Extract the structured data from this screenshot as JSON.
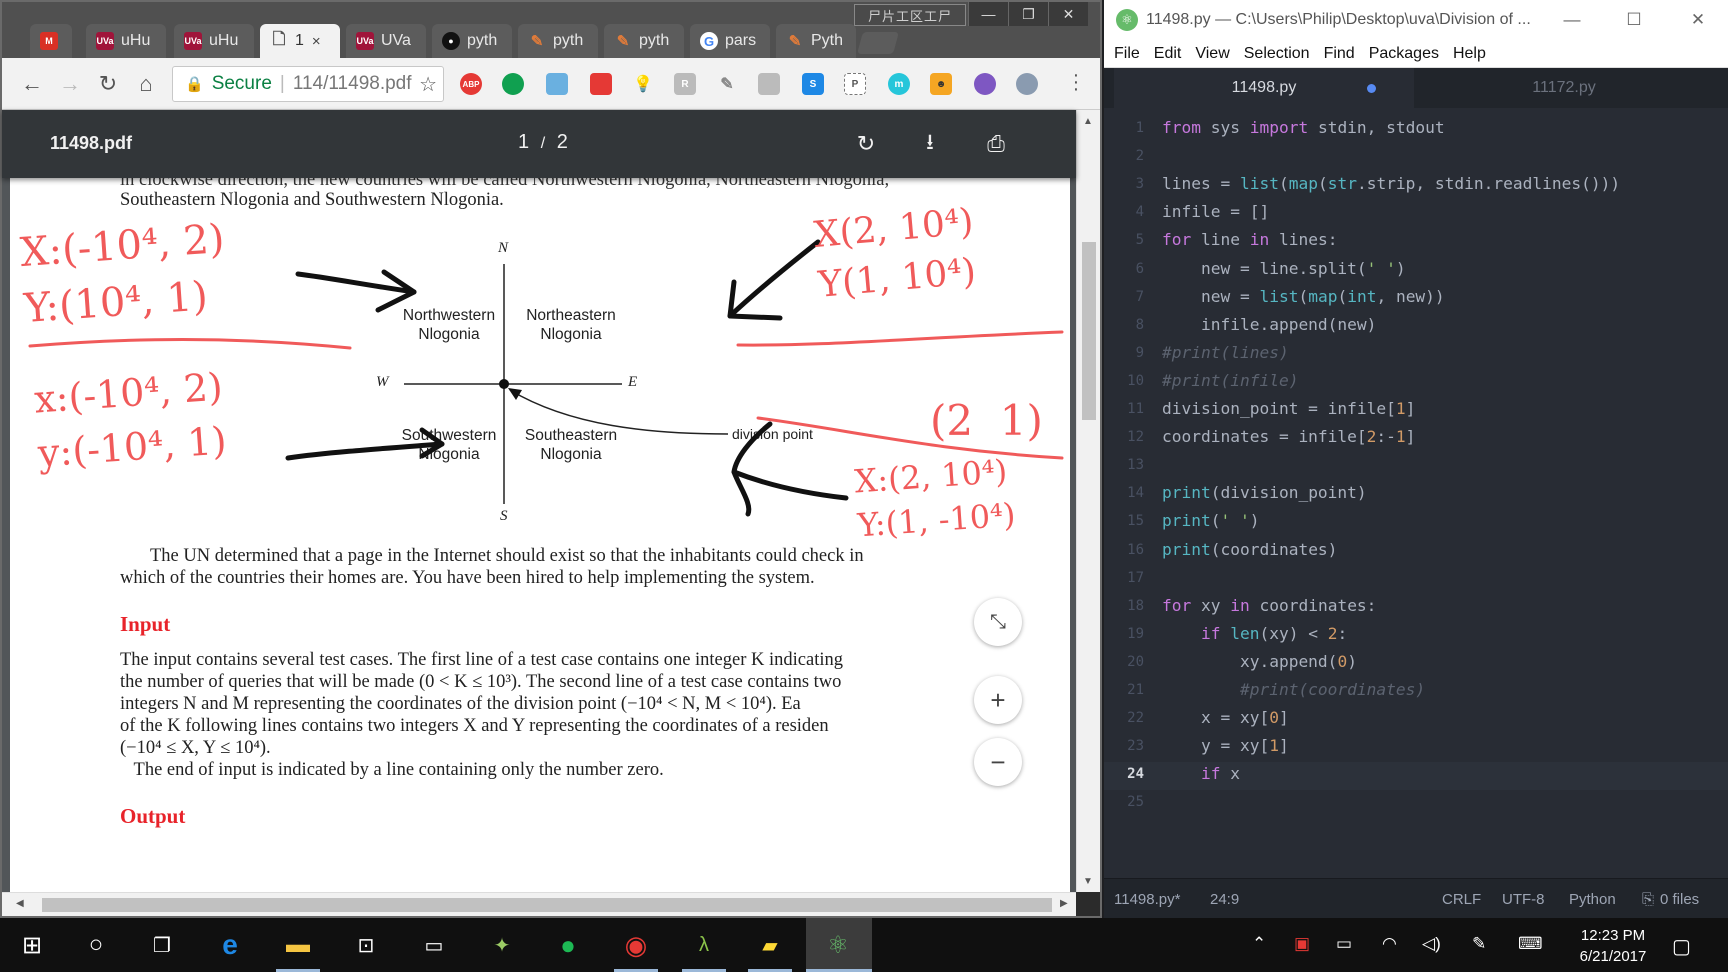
{
  "chrome": {
    "ime_indicator": "尸片工区工尸",
    "tabs": [
      {
        "label": "",
        "icon": "gmail-icon"
      },
      {
        "label": "uHu",
        "icon": "uva-icon"
      },
      {
        "label": "uHu",
        "icon": "uva-icon"
      },
      {
        "label": "1",
        "icon": "document-icon",
        "active": true
      },
      {
        "label": "UVa",
        "icon": "uva-icon"
      },
      {
        "label": "pyth",
        "icon": "github-icon"
      },
      {
        "label": "pyth",
        "icon": "bookmark-icon"
      },
      {
        "label": "pyth",
        "icon": "bookmark-icon"
      },
      {
        "label": "pars",
        "icon": "google-icon"
      },
      {
        "label": "Pyth",
        "icon": "bookmark-icon"
      }
    ],
    "address": {
      "secure_label": "Secure",
      "url": "114/11498.pdf"
    },
    "extensions": [
      "ABP"
    ]
  },
  "pdf": {
    "file_name": "11498.pdf",
    "page_current": "1",
    "page_total": "2",
    "cut_line": "in clockwise direction, the new countries will be called Northwestern Nlogonia, Northeastern Nlogonia,",
    "intro_line": "Southeastern Nlogonia and Southwestern Nlogonia.",
    "diagram": {
      "north": "N",
      "south": "S",
      "west": "W",
      "east": "E",
      "nw": [
        "Northwestern",
        "Nlogonia"
      ],
      "ne": [
        "Northeastern",
        "Nlogonia"
      ],
      "sw": [
        "Southwestern",
        "Nlogonia"
      ],
      "se": [
        "Southeastern",
        "Nlogonia"
      ],
      "division_point": "division point"
    },
    "paragraph1": [
      "The UN determined that a page in the Internet should exist so that the inhabitants could check in",
      "which of the countries their homes are. You have been hired to help implementing the system."
    ],
    "input_heading": "Input",
    "input_lines": [
      "The input contains several test cases.  The first line of a test case contains one integer K indicating",
      "the number of queries that will be made (0 < K ≤ 10³). The second line of a test case contains two",
      "integers N and M representing the coordinates of the division point (−10⁴ < N, M < 10⁴).  Ea",
      "of the K following lines contains two integers X and Y representing the coordinates of a residen",
      "(−10⁴ ≤ X, Y ≤ 10⁴).",
      "   The end of input is indicated by a line containing only the number zero."
    ],
    "output_heading": "Output",
    "annotations": {
      "nw": [
        "X:(-10⁴, 2)",
        "Y:(10⁴, 1)"
      ],
      "sw": [
        "x:(-10⁴, 2)",
        "y:(-10⁴, 1)"
      ],
      "ne": [
        "X(2, 10⁴)",
        "Y(1, 10⁴)"
      ],
      "se_top": "(2  1)",
      "se": [
        "X:(2, 10⁴)",
        "Y:(1, -10⁴)"
      ]
    }
  },
  "atom": {
    "window_title": "11498.py — C:\\Users\\Philip\\Desktop\\uva\\Division of ...",
    "menu": [
      "File",
      "Edit",
      "View",
      "Selection",
      "Find",
      "Packages",
      "Help"
    ],
    "tabs": [
      {
        "label": "11498.py",
        "modified": true
      },
      {
        "label": "11172.py"
      }
    ],
    "current_line": 24,
    "code": [
      "from sys import stdin, stdout",
      "",
      "lines = list(map(str.strip, stdin.readlines()))",
      "infile = []",
      "for line in lines:",
      "    new = line.split(' ')",
      "    new = list(map(int, new))",
      "    infile.append(new)",
      "#print(lines)",
      "#print(infile)",
      "division_point = infile[1]",
      "coordinates = infile[2:-1]",
      "",
      "print(division_point)",
      "print(' ')",
      "print(coordinates)",
      "",
      "for xy in coordinates:",
      "    if len(xy) < 2:",
      "        xy.append(0)",
      "        #print(coordinates)",
      "    x = xy[0]",
      "    y = xy[1]",
      "    if x",
      ""
    ],
    "status": {
      "file": "11498.py*",
      "cursor": "24:9",
      "line_ending": "CRLF",
      "encoding": "UTF-8",
      "grammar": "Python",
      "files": "0 files"
    }
  },
  "taskbar": {
    "time": "12:23 PM",
    "date": "6/21/2017"
  },
  "colors": {
    "annotation": "#f05a5a",
    "pdf_heading": "#e8232a",
    "atom_bg": "#282c34",
    "keyword": "#c678dd",
    "builtin": "#56b6c2",
    "string": "#98c379",
    "number": "#d19a66",
    "comment": "#5c6370"
  }
}
